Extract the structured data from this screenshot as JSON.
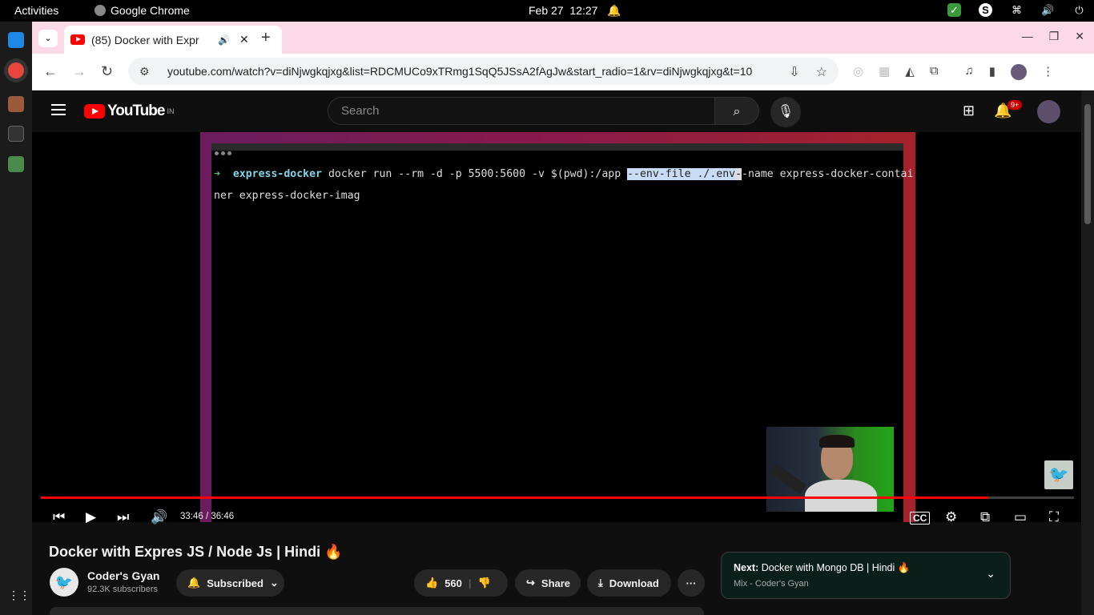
{
  "os": {
    "activities_label": "Activities",
    "app_name": "Google Chrome",
    "date": "Feb 27",
    "time": "12:27"
  },
  "browser": {
    "tab_title": "(85) Docker with Expr",
    "url": "youtube.com/watch?v=diNjwgkqjxg&list=RDCMUCo9xTRmg1SqQ5JSsA2fAgJw&start_radio=1&rv=diNjwgkqjxg&t=10"
  },
  "youtube": {
    "logo_text": "YouTube",
    "region": "IN",
    "search_placeholder": "Search",
    "notifications_badge": "9+"
  },
  "terminal": {
    "prompt_arrow": "➜",
    "dir": "express-docker",
    "cmd_part1": " docker run --rm -d -p 5500:5600 -v $(pwd):/app ",
    "cmd_selected": "--env-file ./.env",
    "cmd_cursor": "-",
    "cmd_part2": "-name express-docker-contai",
    "line2": "ner express-docker-imag"
  },
  "player": {
    "time_current": "33:46",
    "time_separator": " / ",
    "time_total": "36:46",
    "progress_fraction": 0.917
  },
  "video": {
    "title": "Docker with Expres JS / Node Js | Hindi 🔥",
    "channel_name": "Coder's Gyan",
    "subscribers": "92.3K subscribers",
    "subscribed_label": "Subscribed",
    "likes": "560",
    "share_label": "Share",
    "download_label": "Download"
  },
  "up_next": {
    "prefix": "Next:",
    "title": "Docker with Mongo DB | Hindi 🔥",
    "subtitle": "Mix - Coder's Gyan"
  }
}
